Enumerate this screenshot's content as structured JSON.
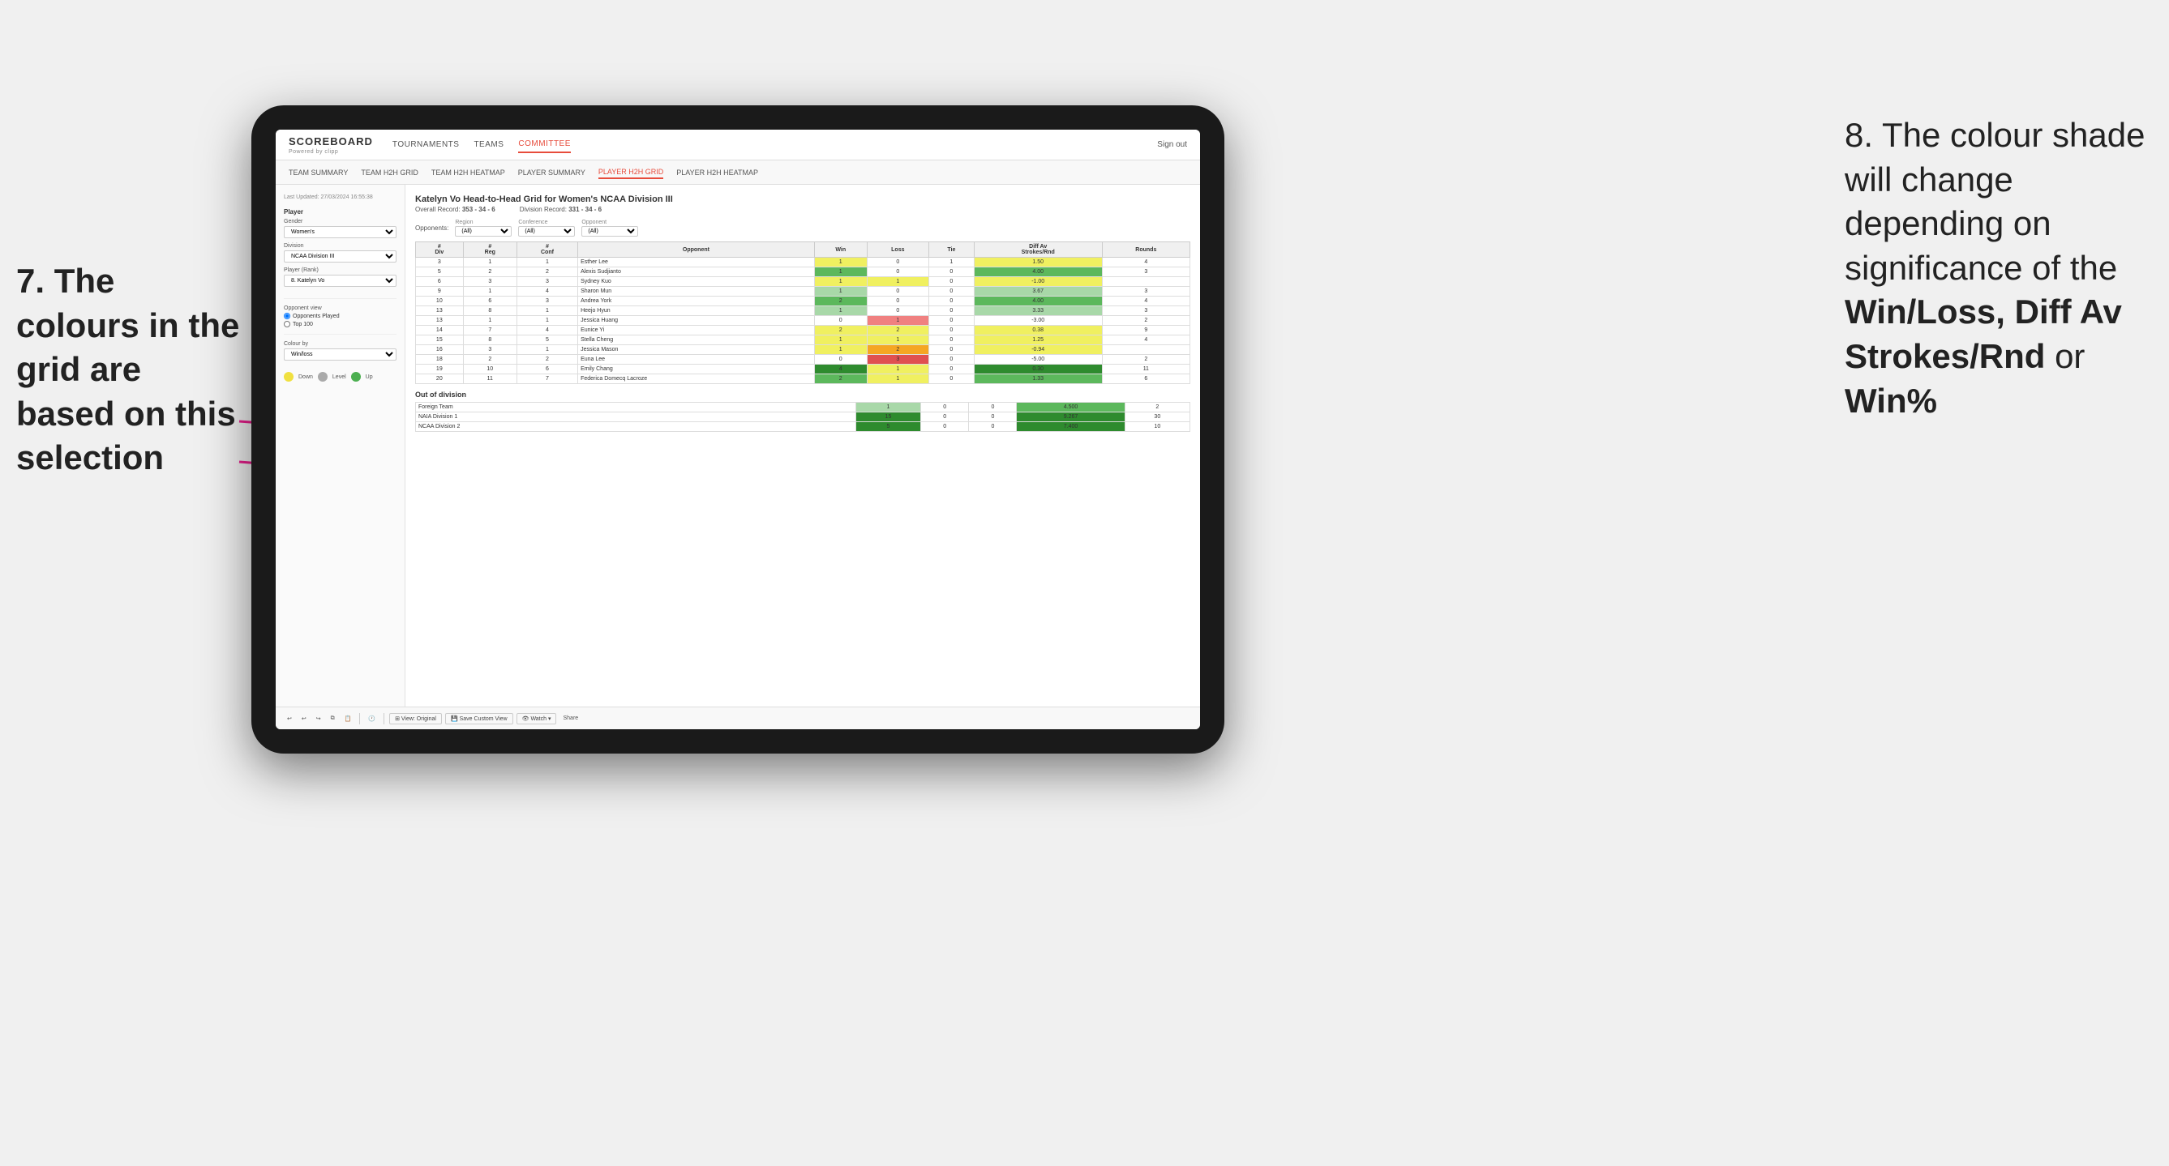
{
  "annotations": {
    "left_title": "7. The colours in the grid are based on this selection",
    "right_title": "8. The colour shade will change depending on significance of the",
    "right_bold1": "Win/Loss, Diff Av Strokes/Rnd",
    "right_bold2": "or",
    "right_bold3": "Win%"
  },
  "nav": {
    "logo": "SCOREBOARD",
    "logo_sub": "Powered by clipp",
    "items": [
      "TOURNAMENTS",
      "TEAMS",
      "COMMITTEE"
    ],
    "active": "COMMITTEE",
    "right": "Sign out"
  },
  "sub_nav": {
    "items": [
      "TEAM SUMMARY",
      "TEAM H2H GRID",
      "TEAM H2H HEATMAP",
      "PLAYER SUMMARY",
      "PLAYER H2H GRID",
      "PLAYER H2H HEATMAP"
    ],
    "active": "PLAYER H2H GRID"
  },
  "sidebar": {
    "timestamp": "Last Updated: 27/03/2024 16:55:38",
    "sections": {
      "player_label": "Player",
      "gender_label": "Gender",
      "gender_value": "Women's",
      "division_label": "Division",
      "division_value": "NCAA Division III",
      "player_rank_label": "Player (Rank)",
      "player_rank_value": "8. Katelyn Vo",
      "opponent_view_label": "Opponent view",
      "opp_played": "Opponents Played",
      "opp_top100": "Top 100",
      "colour_by_label": "Colour by",
      "colour_by_value": "Win/loss"
    },
    "legend": [
      {
        "color": "#f0e040",
        "label": "Down"
      },
      {
        "color": "#aaaaaa",
        "label": "Level"
      },
      {
        "color": "#4caf50",
        "label": "Up"
      }
    ]
  },
  "grid": {
    "title": "Katelyn Vo Head-to-Head Grid for Women's NCAA Division III",
    "overall_record_label": "Overall Record:",
    "overall_record": "353 - 34 - 6",
    "division_record_label": "Division Record:",
    "division_record": "331 - 34 - 6",
    "filters": {
      "opponents_label": "Opponents:",
      "region_label": "Region",
      "region_value": "(All)",
      "conference_label": "Conference",
      "conference_value": "(All)",
      "opponent_label": "Opponent",
      "opponent_value": "(All)"
    },
    "table_headers": [
      "#\nDiv",
      "#\nReg",
      "#\nConf",
      "Opponent",
      "Win",
      "Loss",
      "Tie",
      "Diff Av\nStrokes/Rnd",
      "Rounds"
    ],
    "rows": [
      {
        "div": "3",
        "reg": "1",
        "conf": "1",
        "opponent": "Esther Lee",
        "win": 1,
        "loss": 0,
        "tie": 1,
        "diff": "1.50",
        "rounds": "4",
        "win_color": "cell-yellow",
        "loss_color": "cell-white",
        "diff_color": "cell-green-light"
      },
      {
        "div": "5",
        "reg": "2",
        "conf": "2",
        "opponent": "Alexis Sudjianto",
        "win": 1,
        "loss": 0,
        "tie": 0,
        "diff": "4.00",
        "rounds": "3",
        "win_color": "cell-green-med",
        "loss_color": "cell-white",
        "diff_color": "cell-green-med"
      },
      {
        "div": "6",
        "reg": "3",
        "conf": "3",
        "opponent": "Sydney Kuo",
        "win": 1,
        "loss": 1,
        "tie": 0,
        "diff": "-1.00",
        "rounds": "",
        "win_color": "cell-yellow",
        "loss_color": "cell-yellow",
        "diff_color": "cell-red-light"
      },
      {
        "div": "9",
        "reg": "1",
        "conf": "4",
        "opponent": "Sharon Mun",
        "win": 1,
        "loss": 0,
        "tie": 0,
        "diff": "3.67",
        "rounds": "3",
        "win_color": "cell-green-light",
        "loss_color": "cell-white",
        "diff_color": "cell-green-light"
      },
      {
        "div": "10",
        "reg": "6",
        "conf": "3",
        "opponent": "Andrea York",
        "win": 2,
        "loss": 0,
        "tie": 0,
        "diff": "4.00",
        "rounds": "4",
        "win_color": "cell-green-med",
        "loss_color": "cell-white",
        "diff_color": "cell-green-med"
      },
      {
        "div": "13",
        "reg": "8",
        "conf": "1",
        "opponent": "Heejo Hyun",
        "win": 1,
        "loss": 0,
        "tie": 0,
        "diff": "3.33",
        "rounds": "3",
        "win_color": "cell-green-light",
        "loss_color": "cell-white",
        "diff_color": "cell-green-light"
      },
      {
        "div": "13",
        "reg": "1",
        "conf": "1",
        "opponent": "Jessica Huang",
        "win": 0,
        "loss": 1,
        "tie": 0,
        "diff": "-3.00",
        "rounds": "2",
        "win_color": "cell-white",
        "loss_color": "cell-red-light",
        "diff_color": "cell-red-med"
      },
      {
        "div": "14",
        "reg": "7",
        "conf": "4",
        "opponent": "Eunice Yi",
        "win": 2,
        "loss": 2,
        "tie": 0,
        "diff": "0.38",
        "rounds": "9",
        "win_color": "cell-yellow",
        "loss_color": "cell-yellow",
        "diff_color": "cell-yellow"
      },
      {
        "div": "15",
        "reg": "8",
        "conf": "5",
        "opponent": "Stella Cheng",
        "win": 1,
        "loss": 1,
        "tie": 0,
        "diff": "1.25",
        "rounds": "4",
        "win_color": "cell-yellow",
        "loss_color": "cell-yellow",
        "diff_color": "cell-green-light"
      },
      {
        "div": "16",
        "reg": "3",
        "conf": "1",
        "opponent": "Jessica Mason",
        "win": 1,
        "loss": 2,
        "tie": 0,
        "diff": "-0.94",
        "rounds": "",
        "win_color": "cell-yellow",
        "loss_color": "cell-orange",
        "diff_color": "cell-yellow"
      },
      {
        "div": "18",
        "reg": "2",
        "conf": "2",
        "opponent": "Euna Lee",
        "win": 0,
        "loss": 3,
        "tie": 0,
        "diff": "-5.00",
        "rounds": "2",
        "win_color": "cell-white",
        "loss_color": "cell-red-med",
        "diff_color": "cell-red-med"
      },
      {
        "div": "19",
        "reg": "10",
        "conf": "6",
        "opponent": "Emily Chang",
        "win": 4,
        "loss": 1,
        "tie": 0,
        "diff": "0.30",
        "rounds": "11",
        "win_color": "cell-green-dark",
        "loss_color": "cell-yellow",
        "diff_color": "cell-yellow"
      },
      {
        "div": "20",
        "reg": "11",
        "conf": "7",
        "opponent": "Federica Domecq Lacroze",
        "win": 2,
        "loss": 1,
        "tie": 0,
        "diff": "1.33",
        "rounds": "6",
        "win_color": "cell-green-med",
        "loss_color": "cell-yellow",
        "diff_color": "cell-green-light"
      }
    ],
    "out_of_division_label": "Out of division",
    "out_of_division_rows": [
      {
        "label": "Foreign Team",
        "win": 1,
        "loss": 0,
        "tie": 0,
        "diff": "4.500",
        "rounds": "2",
        "win_color": "cell-green-light",
        "diff_color": "cell-green-med"
      },
      {
        "label": "NAIA Division 1",
        "win": 15,
        "loss": 0,
        "tie": 0,
        "diff": "9.267",
        "rounds": "30",
        "win_color": "cell-green-dark",
        "diff_color": "cell-green-dark"
      },
      {
        "label": "NCAA Division 2",
        "win": 5,
        "loss": 0,
        "tie": 0,
        "diff": "7.400",
        "rounds": "10",
        "win_color": "cell-green-dark",
        "diff_color": "cell-green-dark"
      }
    ]
  },
  "toolbar": {
    "view_original": "⊞ View: Original",
    "save_custom": "💾 Save Custom View",
    "watch": "👁 Watch ▾",
    "share": "Share"
  }
}
